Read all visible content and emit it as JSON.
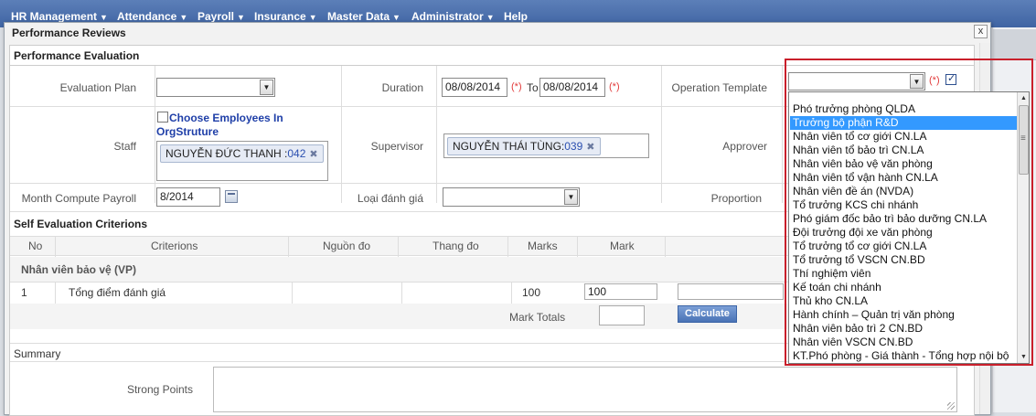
{
  "menubar": {
    "items": [
      {
        "label": "HR Management"
      },
      {
        "label": "Attendance"
      },
      {
        "label": "Payroll"
      },
      {
        "label": "Insurance"
      },
      {
        "label": "Master Data"
      },
      {
        "label": "Administrator"
      },
      {
        "label": "Help"
      }
    ]
  },
  "dialog": {
    "title": "Performance Reviews",
    "close_label": "x"
  },
  "section_performance": {
    "title": "Performance Evaluation"
  },
  "form": {
    "evaluation_plan": {
      "label": "Evaluation Plan",
      "value": ""
    },
    "duration": {
      "label": "Duration",
      "from": "08/08/2014",
      "to_label": "To",
      "to": "08/08/2014",
      "required_mark": "(*)"
    },
    "operation_template": {
      "label": "Operation Template",
      "value": "",
      "required_mark": "(*)",
      "checked": true
    },
    "staff": {
      "label": "Staff",
      "choose_link": "Choose Employees In OrgStruture",
      "tag_name": "NGUYỄN ĐỨC THANH :",
      "tag_code": "042"
    },
    "supervisor": {
      "label": "Supervisor",
      "tag_name": "NGUYỄN THÁI TÙNG:",
      "tag_code": "039"
    },
    "approver": {
      "label": "Approver"
    },
    "month_compute": {
      "label": "Month Compute Payroll",
      "value": "8/2014"
    },
    "loai_danh_gia": {
      "label": "Loại đánh giá",
      "value": ""
    },
    "proportion": {
      "label": "Proportion"
    }
  },
  "section_self": {
    "title": "Self Evaluation Criterions"
  },
  "criterions": {
    "headers": {
      "no": "No",
      "criterions": "Criterions",
      "nguon_do": "Nguồn đo",
      "thang_do": "Thang đo",
      "marks": "Marks",
      "mark": "Mark"
    },
    "group": "Nhân viên bảo vệ (VP)",
    "rows": [
      {
        "no": "1",
        "criterion": "Tổng điểm đánh giá",
        "marks": "100",
        "mark": "100"
      }
    ],
    "mark_totals_label": "Mark Totals",
    "calculate_label": "Calculate"
  },
  "summary": {
    "title": "Summary",
    "strong_points_label": "Strong Points"
  },
  "template_dropdown": {
    "options": [
      "Phó trưởng phòng QLDA",
      "Trưởng bộ phận R&D",
      "Nhân viên tổ cơ giới CN.LA",
      "Nhân viên tổ bảo trì CN.LA",
      "Nhân viên bảo vệ văn phòng",
      "Nhân viên tổ vận hành CN.LA",
      "Nhân viên đề án (NVDA)",
      "Tổ trưởng KCS chi nhánh",
      "Phó giám đốc bảo trì bảo dưỡng CN.LA",
      "Đội trưởng đội xe văn phòng",
      "Tổ trưởng tổ cơ giới CN.LA",
      "Tổ trưởng tổ VSCN CN.BD",
      "Thí nghiệm viên",
      "Kế toán chi nhánh",
      "Thủ kho CN.LA",
      "Hành chính – Quản trị văn phòng",
      "Nhân viên bảo trì 2 CN.BD",
      "Nhân viên VSCN CN.BD",
      "KT.Phó phòng - Giá thành - Tổng hợp nội bộ"
    ],
    "selected_index": 1,
    "highlight_color": "#c91f2b",
    "selection_color": "#3399ff"
  },
  "colors": {
    "menubar": "#4a6ead",
    "link": "#1f3fa8",
    "required": "#e23b3b"
  }
}
